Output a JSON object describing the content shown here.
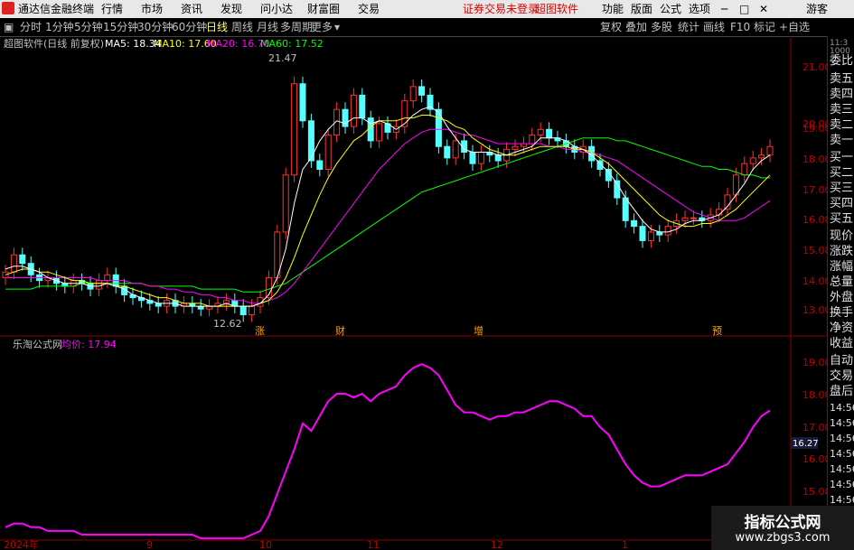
{
  "menubar": {
    "app_title": "通达信金融终端",
    "items": [
      "行情",
      "市场",
      "资讯",
      "发现",
      "问小达",
      "财富圈",
      "交易"
    ],
    "notice": "证券交易未登录",
    "software": "超图软件",
    "right_items": [
      "功能",
      "版面",
      "公式",
      "选项"
    ],
    "user": "游客"
  },
  "toolbar": {
    "periods": [
      "分时",
      "1分钟",
      "5分钟",
      "15分钟",
      "30分钟",
      "60分钟",
      "日线",
      "周线",
      "月线",
      "多周期",
      "更多"
    ],
    "active": "日线",
    "right_items": [
      "复权",
      "叠加",
      "多股",
      "统计",
      "画线",
      "F10",
      "标记",
      "+自选"
    ]
  },
  "main": {
    "title": "超图软件(日线 前复权)",
    "ma": [
      {
        "label": "MA5: 18.34",
        "color": "#ffffff"
      },
      {
        "label": "MA10: 17.60",
        "color": "#ffff00"
      },
      {
        "label": "MA20: 16.70",
        "color": "#ff00ff"
      },
      {
        "label": "MA60: 17.52",
        "color": "#00ff00"
      }
    ],
    "high_label": "21.47",
    "low_label": "12.62",
    "axis": [
      "21.00",
      "20.00",
      "19.00",
      "18.00",
      "17.00",
      "16.00",
      "15.00",
      "14.00",
      "13.00"
    ],
    "markers": [
      "涨",
      "财",
      "增",
      "预"
    ]
  },
  "sub": {
    "title": "乐淘公式网",
    "line_label": "均价: 17.94",
    "axis": [
      "19.00",
      "18.00",
      "17.00",
      "16.00",
      "15.00"
    ],
    "current_value": "16.27"
  },
  "xaxis": [
    "2024年",
    "9",
    "10",
    "11",
    "12",
    "1"
  ],
  "panel": {
    "items": [
      "委比",
      "卖五",
      "卖四",
      "卖三",
      "卖二",
      "卖一",
      "买一",
      "买二",
      "买三",
      "买四",
      "买五",
      "现价",
      "涨跌",
      "涨幅",
      "总量",
      "外盘",
      "换手",
      "净资",
      "收益"
    ],
    "lower": [
      "自动",
      "交易",
      "盘后"
    ],
    "times": [
      "14:56",
      "14:56",
      "14:56",
      "14:56",
      "14:56",
      "14:56",
      "14:56",
      "14:56",
      "14:56"
    ],
    "small_top": "11:3",
    "small_bottom": "1000"
  },
  "watermark": {
    "line1": "指标公式网",
    "line2": "www.zbgs3.com"
  },
  "chart_data": {
    "type": "candlestick",
    "ylim": [
      12.4,
      21.9
    ],
    "closes": [
      14.2,
      14.8,
      14.5,
      14.1,
      13.9,
      14.0,
      13.8,
      13.7,
      13.9,
      13.8,
      13.6,
      13.9,
      14.1,
      13.7,
      13.4,
      13.3,
      13.2,
      13.1,
      13.0,
      13.2,
      13.0,
      13.1,
      13.0,
      12.9,
      13.0,
      13.1,
      13.2,
      13.0,
      12.7,
      13.0,
      13.3,
      14.0,
      15.6,
      17.6,
      20.8,
      19.5,
      18.1,
      17.8,
      19.0,
      19.9,
      19.3,
      20.4,
      19.6,
      18.8,
      19.4,
      19.1,
      19.3,
      20.2,
      20.7,
      20.4,
      19.9,
      18.6,
      18.2,
      18.8,
      18.4,
      18.0,
      18.4,
      18.3,
      18.1,
      18.5,
      18.6,
      18.7,
      19.0,
      19.2,
      18.9,
      18.8,
      18.6,
      18.4,
      18.6,
      18.1,
      17.8,
      17.4,
      16.8,
      16.0,
      15.8,
      15.3,
      15.6,
      15.5,
      15.8,
      16.0,
      16.1,
      16.1,
      16.0,
      16.2,
      16.4,
      16.9,
      17.6,
      18.0,
      18.2,
      18.3,
      18.6
    ],
    "ma5": [
      14.3,
      14.4,
      14.4,
      14.3,
      14.2,
      14.0,
      13.9,
      13.8,
      13.8,
      13.8,
      13.7,
      13.7,
      13.8,
      13.7,
      13.6,
      13.4,
      13.3,
      13.2,
      13.1,
      13.1,
      13.1,
      13.0,
      13.0,
      13.0,
      13.0,
      13.0,
      13.1,
      13.0,
      13.0,
      13.0,
      13.1,
      13.4,
      14.0,
      15.0,
      16.6,
      17.8,
      18.2,
      18.8,
      19.2,
      19.5,
      19.4,
      19.6,
      19.6,
      19.4,
      19.5,
      19.4,
      19.2,
      19.4,
      19.7,
      19.9,
      20.0,
      19.8,
      19.3,
      18.9,
      18.5,
      18.4,
      18.4,
      18.4,
      18.3,
      18.3,
      18.4,
      18.5,
      18.6,
      18.9,
      18.9,
      18.9,
      18.8,
      18.6,
      18.5,
      18.3,
      18.0,
      17.7,
      17.3,
      16.8,
      16.4,
      16.0,
      15.7,
      15.6,
      15.6,
      15.7,
      15.9,
      16.0,
      16.0,
      16.1,
      16.2,
      16.5,
      16.9,
      17.3,
      17.8,
      18.1,
      18.3
    ],
    "ma10": [
      14.1,
      14.2,
      14.3,
      14.3,
      14.2,
      14.2,
      14.1,
      14.0,
      13.9,
      13.9,
      13.8,
      13.8,
      13.8,
      13.7,
      13.7,
      13.6,
      13.5,
      13.4,
      13.3,
      13.3,
      13.2,
      13.1,
      13.1,
      13.1,
      13.0,
      13.0,
      13.0,
      13.0,
      13.0,
      13.0,
      13.1,
      13.2,
      13.5,
      14.0,
      14.7,
      15.5,
      16.2,
      16.9,
      17.5,
      18.0,
      18.4,
      18.8,
      19.0,
      19.3,
      19.5,
      19.5,
      19.5,
      19.6,
      19.6,
      19.7,
      19.7,
      19.6,
      19.5,
      19.3,
      19.2,
      18.9,
      18.7,
      18.5,
      18.4,
      18.3,
      18.3,
      18.4,
      18.5,
      18.6,
      18.6,
      18.6,
      18.6,
      18.5,
      18.5,
      18.4,
      18.2,
      18.0,
      17.7,
      17.4,
      17.1,
      16.8,
      16.5,
      16.2,
      16.0,
      15.9,
      15.8,
      15.8,
      15.9,
      15.9,
      16.0,
      16.2,
      16.4,
      16.7,
      17.0,
      17.3,
      17.6
    ],
    "ma20": [
      14.0,
      14.0,
      14.0,
      14.0,
      14.0,
      14.0,
      14.0,
      14.0,
      14.0,
      14.0,
      14.0,
      13.9,
      13.9,
      13.9,
      13.9,
      13.8,
      13.8,
      13.7,
      13.7,
      13.6,
      13.6,
      13.5,
      13.5,
      13.4,
      13.4,
      13.3,
      13.3,
      13.2,
      13.2,
      13.1,
      13.1,
      13.2,
      13.3,
      13.5,
      13.8,
      14.2,
      14.6,
      15.0,
      15.4,
      15.8,
      16.2,
      16.6,
      17.0,
      17.4,
      17.8,
      18.1,
      18.4,
      18.7,
      18.9,
      19.1,
      19.2,
      19.2,
      19.2,
      19.1,
      19.0,
      19.0,
      18.9,
      18.8,
      18.7,
      18.7,
      18.7,
      18.7,
      18.7,
      18.7,
      18.6,
      18.6,
      18.5,
      18.5,
      18.4,
      18.4,
      18.3,
      18.2,
      18.1,
      17.9,
      17.7,
      17.5,
      17.3,
      17.1,
      16.9,
      16.7,
      16.5,
      16.3,
      16.2,
      16.1,
      16.0,
      16.0,
      16.0,
      16.1,
      16.3,
      16.5,
      16.7
    ],
    "ma60": [
      13.6,
      13.6,
      13.6,
      13.6,
      13.7,
      13.7,
      13.7,
      13.7,
      13.7,
      13.8,
      13.8,
      13.8,
      13.8,
      13.8,
      13.8,
      13.8,
      13.8,
      13.7,
      13.7,
      13.7,
      13.7,
      13.7,
      13.7,
      13.6,
      13.6,
      13.6,
      13.6,
      13.6,
      13.5,
      13.5,
      13.5,
      13.6,
      13.7,
      13.8,
      14.0,
      14.2,
      14.4,
      14.6,
      14.8,
      15.0,
      15.2,
      15.4,
      15.6,
      15.8,
      16.0,
      16.2,
      16.4,
      16.6,
      16.8,
      17.0,
      17.1,
      17.2,
      17.3,
      17.4,
      17.5,
      17.6,
      17.7,
      17.8,
      17.9,
      18.0,
      18.1,
      18.2,
      18.3,
      18.4,
      18.5,
      18.6,
      18.7,
      18.8,
      18.9,
      18.9,
      18.9,
      18.9,
      18.8,
      18.8,
      18.7,
      18.6,
      18.5,
      18.4,
      18.3,
      18.2,
      18.1,
      18.0,
      17.9,
      17.9,
      17.8,
      17.8,
      17.7,
      17.6,
      17.6,
      17.5,
      17.5
    ],
    "sub_ylim": [
      14.6,
      19.4
    ],
    "avg_line": [
      14.8,
      14.9,
      14.9,
      14.8,
      14.8,
      14.7,
      14.7,
      14.7,
      14.7,
      14.6,
      14.6,
      14.6,
      14.6,
      14.6,
      14.6,
      14.6,
      14.6,
      14.6,
      14.6,
      14.6,
      14.6,
      14.6,
      14.6,
      14.5,
      14.5,
      14.5,
      14.5,
      14.5,
      14.5,
      14.6,
      14.7,
      15.1,
      15.7,
      16.3,
      16.9,
      17.6,
      17.4,
      17.8,
      18.2,
      18.4,
      18.4,
      18.3,
      18.4,
      18.2,
      18.4,
      18.5,
      18.6,
      18.9,
      19.1,
      19.2,
      19.1,
      18.9,
      18.5,
      18.1,
      17.9,
      17.9,
      17.8,
      17.7,
      17.8,
      17.8,
      17.9,
      17.9,
      18.0,
      18.1,
      18.2,
      18.2,
      18.1,
      18.0,
      17.8,
      17.8,
      17.5,
      17.3,
      16.9,
      16.5,
      16.2,
      16.0,
      15.9,
      15.9,
      16.0,
      16.1,
      16.2,
      16.2,
      16.2,
      16.3,
      16.4,
      16.5,
      16.8,
      17.1,
      17.5,
      17.8,
      17.95
    ]
  }
}
